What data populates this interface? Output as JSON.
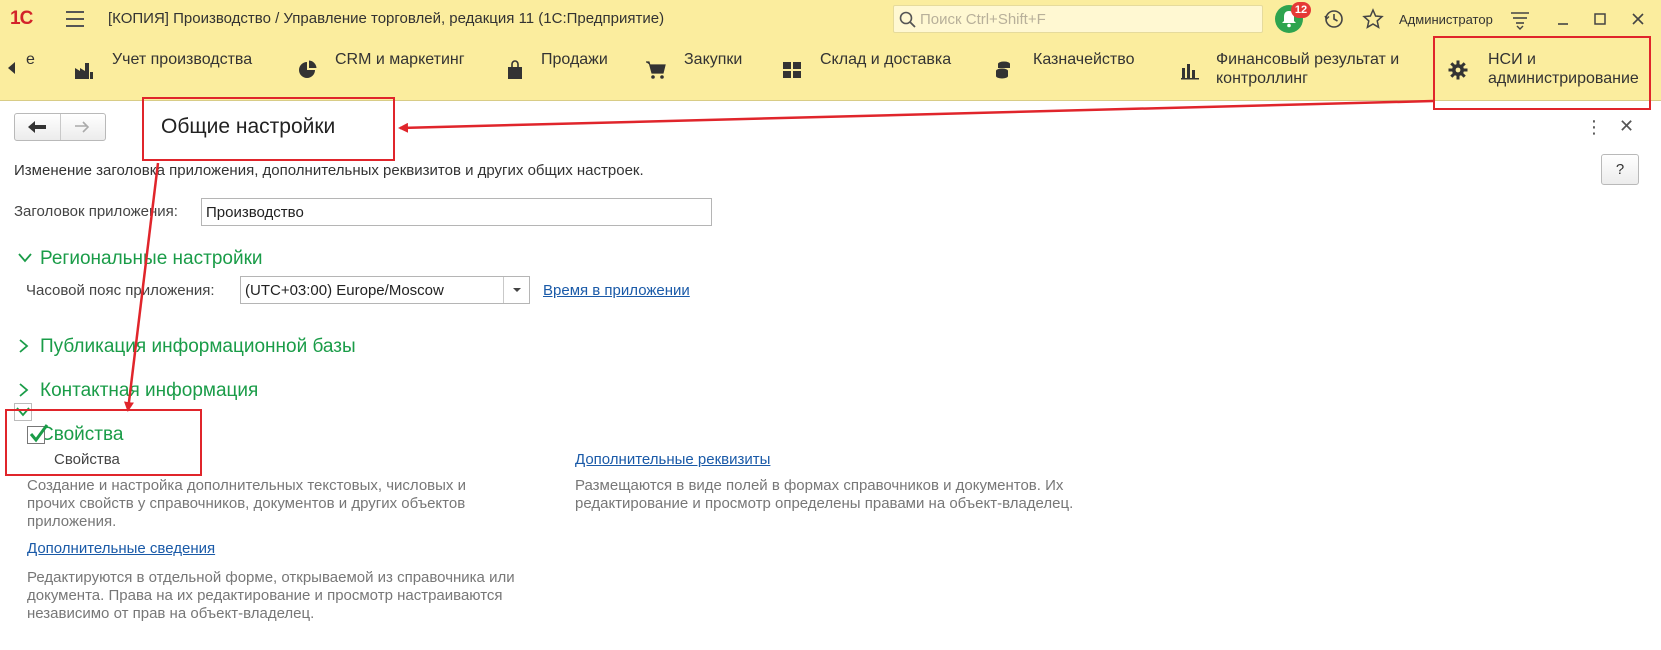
{
  "window": {
    "logo": "1С",
    "title": "[КОПИЯ] Производство / Управление торговлей, редакция 11  (1С:Предприятие)",
    "search_placeholder": "Поиск Ctrl+Shift+F",
    "notifications_count": "12",
    "user": "Администратор"
  },
  "sections": {
    "partial_item": "е",
    "items": [
      {
        "label": "Учет производства",
        "icon": "factory-icon"
      },
      {
        "label": "CRM и маркетинг",
        "icon": "pie-chart-icon"
      },
      {
        "label": "Продажи",
        "icon": "shopping-bag-icon"
      },
      {
        "label": "Закупки",
        "icon": "cart-icon"
      },
      {
        "label": "Склад и доставка",
        "icon": "warehouse-grid-icon"
      },
      {
        "label": "Казначейство",
        "icon": "coins-icon"
      },
      {
        "label": "Финансовый результат и контроллинг",
        "icon": "bar-chart-icon"
      },
      {
        "label": "НСИ и администрирование",
        "icon": "gear-icon"
      }
    ]
  },
  "form": {
    "title": "Общие настройки",
    "description": "Изменение заголовка приложения, дополнительных реквизитов и других общих настроек.",
    "help_label": "?",
    "app_title_label": "Заголовок приложения:",
    "app_title_value": "Производство",
    "regional": {
      "header": "Региональные настройки",
      "timezone_label": "Часовой пояс приложения:",
      "timezone_value": "(UTC+03:00) Europe/Moscow",
      "time_link": "Время в приложении"
    },
    "publication_header": "Публикация информационной базы",
    "contacts_header": "Контактная информация",
    "properties": {
      "header": "Свойства",
      "checkbox_label": "Свойства",
      "checked": true,
      "note1": "Создание и настройка дополнительных текстовых, числовых и прочих свойств у справочников, документов и других объектов приложения.",
      "extra_info_link": "Дополнительные сведения",
      "note2": "Редактируются в отдельной форме, открываемой из справочника или документа. Права на их редактирование и просмотр настраиваются независимо от прав на объект-владелец.",
      "extra_attrs_link": "Дополнительные реквизиты",
      "note3": "Размещаются в виде полей в формах справочников и документов. Их редактирование и просмотр определены правами на объект-владелец."
    }
  },
  "colors": {
    "toolbar": "#fbed9e",
    "group_header": "#1a9c48",
    "link": "#1a5aa8",
    "annotation": "#e0252b"
  }
}
